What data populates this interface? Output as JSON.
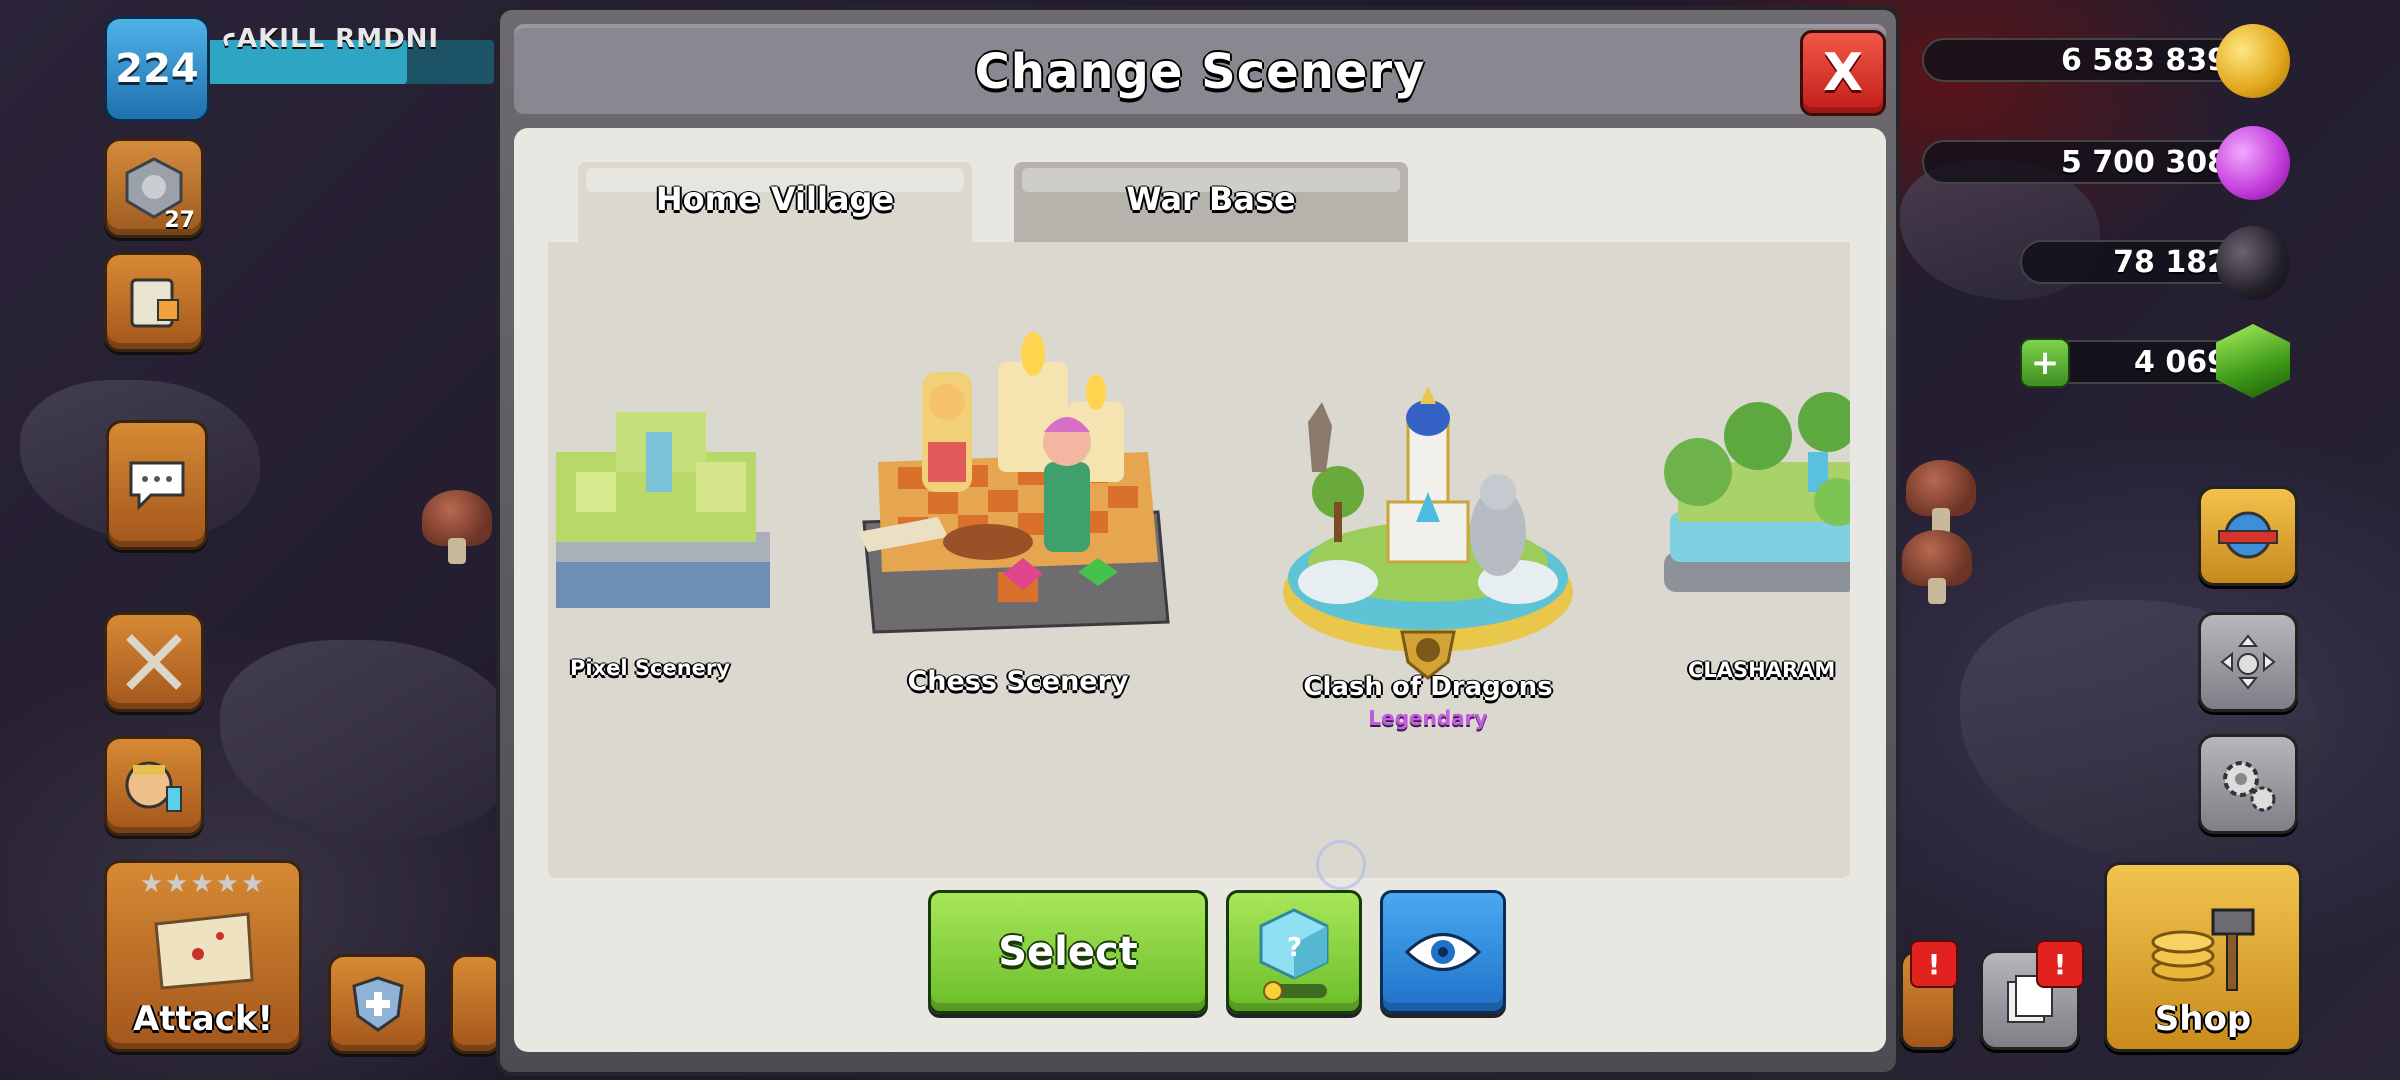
{
  "player": {
    "level": "224",
    "name": "ꜥAKILL RMDNI",
    "trophy_count": "27"
  },
  "resources": {
    "gold": "6 583 839",
    "elixir": "5 700 308",
    "dark_elixir": "78 182",
    "gems": "4 069"
  },
  "attack": {
    "label": "Attack!",
    "stars": "★★★★★"
  },
  "shop": {
    "label": "Shop",
    "badges": [
      "!",
      "!"
    ]
  },
  "dialog": {
    "title": "Change Scenery",
    "close_label": "X",
    "tabs": [
      {
        "label": "Home Village"
      },
      {
        "label": "War Base"
      }
    ],
    "sceneries": [
      {
        "name": "Pixel Scenery",
        "rarity": ""
      },
      {
        "name": "Chess Scenery",
        "rarity": ""
      },
      {
        "name": "Clash of Dragons",
        "rarity": "Legendary"
      },
      {
        "name": "CLASHARAM",
        "rarity": ""
      }
    ],
    "select_label": "Select"
  },
  "colors": {
    "legendary": "#c35be0",
    "select_green": "#7fcf36",
    "preview_blue": "#2b87dc",
    "close_red": "#d8312a"
  }
}
